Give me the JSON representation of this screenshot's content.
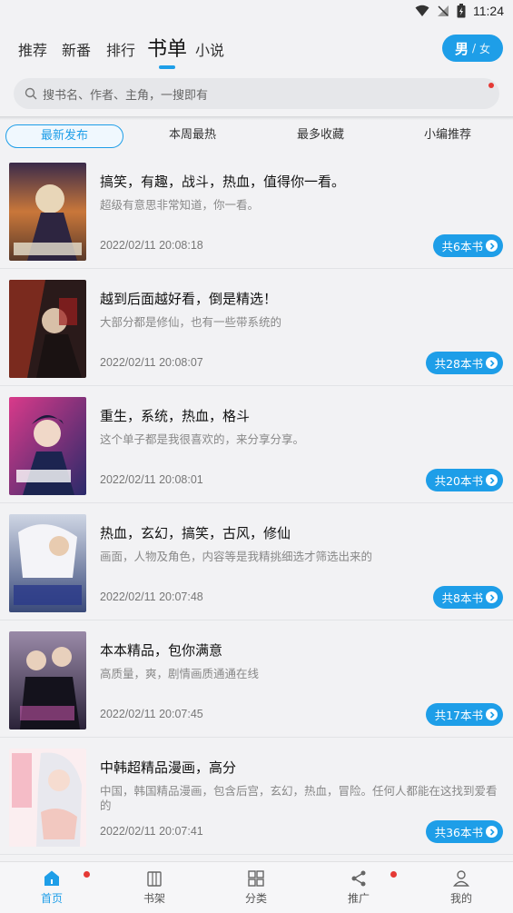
{
  "status": {
    "time": "11:24"
  },
  "top_tabs": [
    "推荐",
    "新番",
    "排行",
    "书单",
    "小说"
  ],
  "gender": {
    "male": "男",
    "sep": "/",
    "female": "女"
  },
  "search": {
    "placeholder": "搜书名、作者、主角，一搜即有"
  },
  "filter_tabs": [
    "最新发布",
    "本周最热",
    "最多收藏",
    "小编推荐"
  ],
  "lists": [
    {
      "title": "搞笑，有趣，战斗，热血，值得你一看。",
      "desc": "超级有意思非常知道，你一看。",
      "date": "2022/02/11 20:08:18",
      "count": "共6本书"
    },
    {
      "title": "越到后面越好看，倒是精选！",
      "desc": "大部分都是修仙，也有一些带系统的",
      "date": "2022/02/11 20:08:07",
      "count": "共28本书"
    },
    {
      "title": "重生，系统，热血，格斗",
      "desc": "这个单子都是我很喜欢的，来分享分享。",
      "date": "2022/02/11 20:08:01",
      "count": "共20本书"
    },
    {
      "title": "热血，玄幻，搞笑，古风，修仙",
      "desc": "画面，人物及角色，内容等是我精挑细选才筛选出来的",
      "date": "2022/02/11 20:07:48",
      "count": "共8本书"
    },
    {
      "title": "本本精品，包你满意",
      "desc": "高质量，爽，剧情画质通通在线",
      "date": "2022/02/11 20:07:45",
      "count": "共17本书"
    },
    {
      "title": "中韩超精品漫画，高分",
      "desc": "中国，韩国精品漫画，包含后宫，玄幻，热血，冒险。任何人都能在这找到爱看的",
      "date": "2022/02/11 20:07:41",
      "count": "共36本书"
    }
  ],
  "bottom_nav": [
    "首页",
    "书架",
    "分类",
    "推广",
    "我的"
  ],
  "colors": {
    "accent": "#1e9ee8",
    "badge": "#e53935"
  }
}
